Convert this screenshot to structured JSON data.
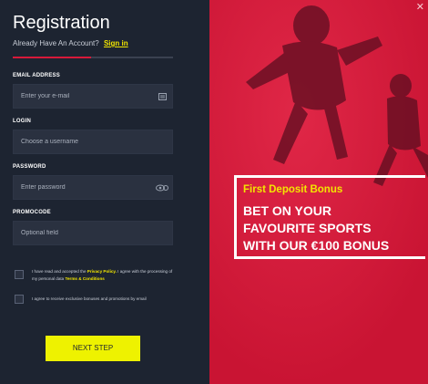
{
  "form": {
    "title": "Registration",
    "account_question": "Already Have An Account?",
    "sign_in": "Sign in",
    "email_label": "EMAIL ADDRESS",
    "email_placeholder": "Enter your e-mail",
    "login_label": "LOGIN",
    "login_placeholder": "Choose a username",
    "password_label": "PASSWORD",
    "password_placeholder": "Enter password",
    "promocode_label": "PROMOCODE",
    "promocode_placeholder": "Optional field",
    "terms_pre": "I have read and accepted the",
    "terms_privacy": "Privacy Policy.",
    "terms_mid": "I agree with the processing of my personal data",
    "terms_link": "Terms & Conditions",
    "promo_consent": "I agree to receive exclusive bonuses and promotions by email",
    "next_button": "NEXT STEP"
  },
  "promo": {
    "bonus_title": "First Deposit Bonus",
    "headline_1": "BET ON YOUR",
    "headline_2": "FAVOURITE SPORTS",
    "headline_3": "WITH OUR €100 BONUS"
  },
  "colors": {
    "accent": "#d7193a",
    "highlight": "#f2e600",
    "panel": "#1d2431"
  },
  "icons": [
    "email-card-icon",
    "password-eye-icon",
    "close-icon"
  ]
}
